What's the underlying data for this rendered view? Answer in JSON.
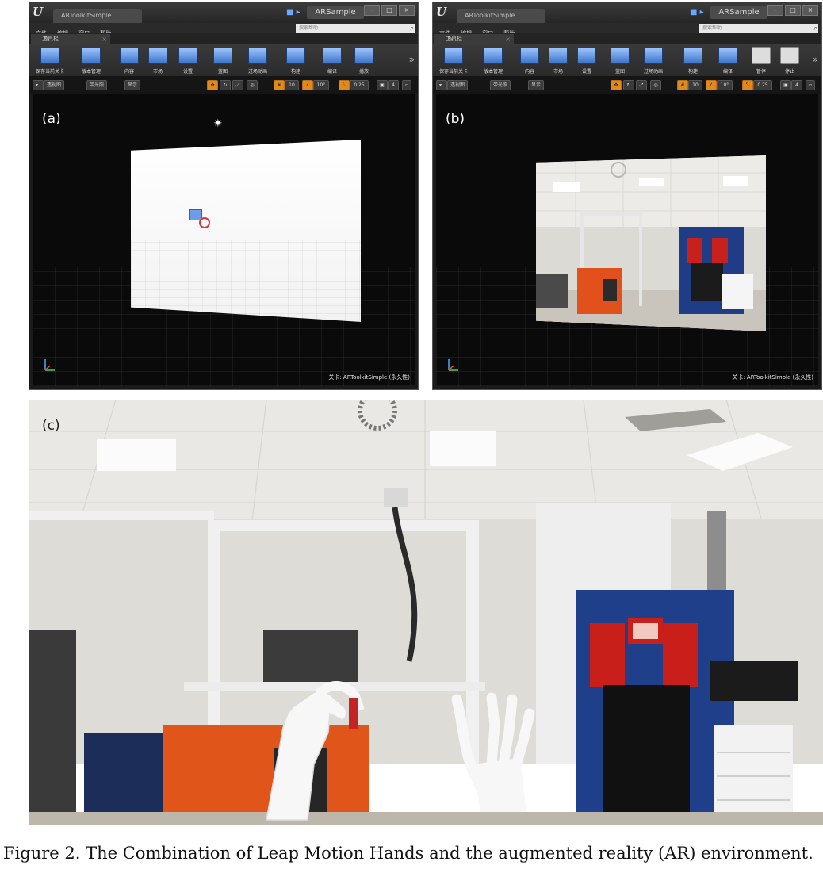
{
  "editor": {
    "tab_title_a": "ARToolkitSimple",
    "tab_title_b": "ARToolkitSimple",
    "project_name": "ARSample",
    "window_buttons": [
      "–",
      "□",
      "×"
    ],
    "menu": [
      "文件",
      "编辑",
      "窗口",
      "帮助"
    ],
    "search_placeholder": "搜索帮助",
    "tools_tab_label": "工具栏",
    "toolbar_a": [
      "保存当前关卡",
      "版本管理",
      "内容",
      "市场",
      "设置",
      "蓝图",
      "过场动画",
      "构建",
      "编译",
      "播放"
    ],
    "toolbar_b": [
      "保存当前关卡",
      "版本管理",
      "内容",
      "市场",
      "设置",
      "蓝图",
      "过场动画",
      "构建",
      "编译",
      "暂停",
      "停止"
    ],
    "viewport_buttons": [
      "透视图",
      "带光照",
      "显示"
    ],
    "snap_values": [
      "10",
      "10°",
      "0.25",
      "4"
    ],
    "status_a": "关卡: ARToolkitSimple (永久性)",
    "status_b": "关卡: ARToolkitSimple (永久性)"
  },
  "labels": {
    "a": "(a)",
    "b": "(b)",
    "c": "(c)"
  },
  "caption": "Figure 2. The Combination of Leap Motion Hands and the augmented reality (AR) environment."
}
